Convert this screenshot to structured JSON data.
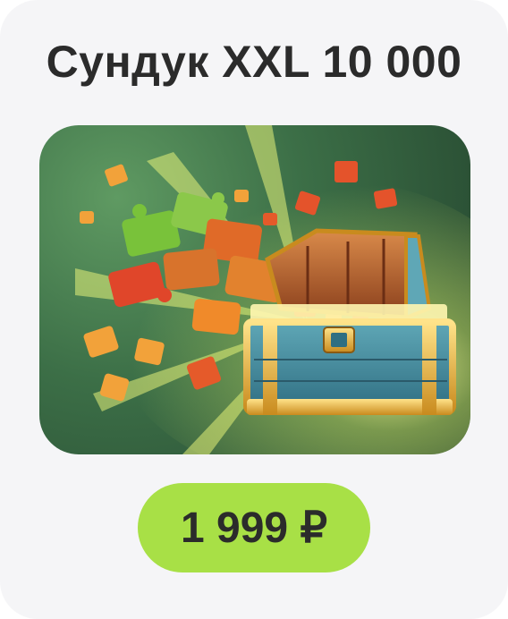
{
  "product": {
    "title": "Сундук XXL 10 000",
    "price_label": "1 999 ₽",
    "image_icon": "treasure-chest-with-puzzle-pieces",
    "colors": {
      "price_button": "#a8e046",
      "image_bg_light": "#5f9a62",
      "image_bg_dark": "#24442e"
    }
  }
}
